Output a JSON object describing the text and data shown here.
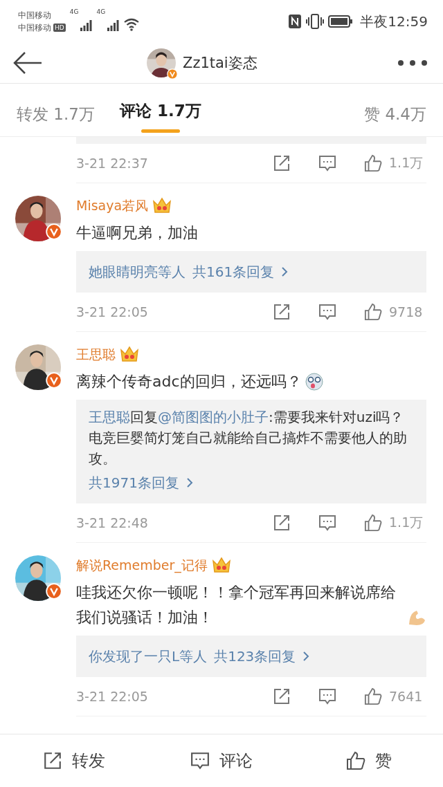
{
  "status_bar": {
    "carriers": [
      "中国移动",
      "中国移动"
    ],
    "hd": "HD",
    "networks": [
      "4G",
      "4G"
    ],
    "time": "半夜12:59"
  },
  "header": {
    "title": "Zz1tai姿态"
  },
  "tabs": [
    {
      "label": "转发 1.7万",
      "selected": false
    },
    {
      "label": "评论 1.7万",
      "selected": true
    },
    {
      "label": "赞 4.4万",
      "selected": false
    }
  ],
  "comments": [
    {
      "kind": "cut",
      "time": "3-21 22:37",
      "likes": "1.1万"
    },
    {
      "kind": "full",
      "name": "Misaya若风",
      "text": "牛逼啊兄弟，加油",
      "replies": {
        "kind": "summary",
        "users": "她眼睛明亮等人",
        "count": "共161条回复"
      },
      "time": "3-21 22:05",
      "likes": "9718"
    },
    {
      "kind": "full",
      "name": "王思聪",
      "text": "离辣个传奇adc的回归，还远吗？",
      "emoji": {
        "kind": "dog"
      },
      "replies": {
        "kind": "quote",
        "author": "王思聪",
        "verb": "回复",
        "mention": "@简图图的小肚子",
        "body": ":需要我来针对uzi吗？电竞巨婴简灯笼自己就能给自己搞炸不需要他人的助攻。",
        "count": "共1971条回复"
      },
      "time": "3-21 22:48",
      "likes": "1.1万"
    },
    {
      "kind": "full",
      "name": "解说Remember_记得",
      "text": "哇我还欠你一顿呢！！拿个冠军再回来解说席给我们说骚话！加油！",
      "emoji": {
        "kind": "arm"
      },
      "replies": {
        "kind": "summary",
        "users": "你发现了一只L等人",
        "count": "共123条回复"
      },
      "time": "3-21 22:05",
      "likes": "7641"
    }
  ],
  "bottom_bar": [
    {
      "kind": "repost",
      "label": "转发"
    },
    {
      "kind": "comment",
      "label": "评论"
    },
    {
      "kind": "like",
      "label": "赞"
    }
  ]
}
